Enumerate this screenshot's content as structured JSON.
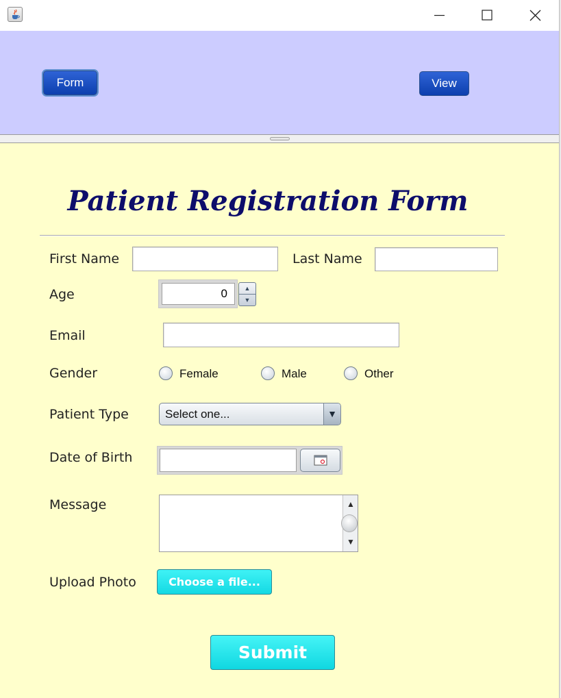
{
  "window": {
    "app_icon": "java-cup-icon",
    "controls": [
      "minimize-icon",
      "maximize-icon",
      "close-icon"
    ]
  },
  "top_panel": {
    "form_button": "Form",
    "view_button": "View",
    "background": "#ccccff"
  },
  "form": {
    "title": "Patient Registration Form",
    "first_name_label": "First Name",
    "first_name_value": "",
    "last_name_label": "Last Name",
    "last_name_value": "",
    "age_label": "Age",
    "age_value": "0",
    "email_label": "Email",
    "email_value": "",
    "gender_label": "Gender",
    "gender_options": [
      "Female",
      "Male",
      "Other"
    ],
    "patient_type_label": "Patient Type",
    "patient_type_selected": "Select one...",
    "dob_label": "Date of Birth",
    "dob_value": "",
    "message_label": "Message",
    "message_value": "",
    "upload_label": "Upload Photo",
    "upload_button": "Choose a file...",
    "submit_button": "Submit",
    "background": "#ffffcc",
    "title_color": "#0d0d6b",
    "accent_cyan": "#14d9e3"
  }
}
